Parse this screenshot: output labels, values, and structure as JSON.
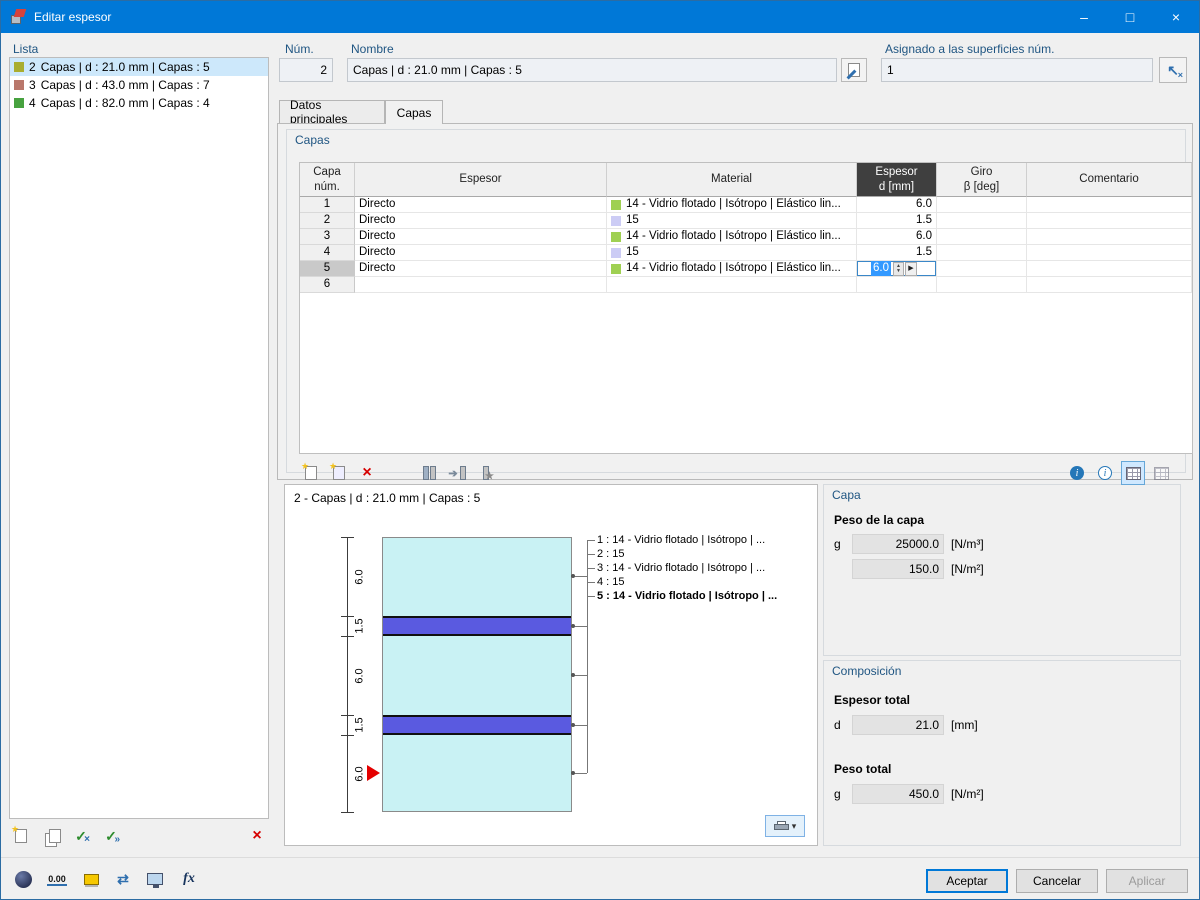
{
  "window": {
    "title": "Editar espesor"
  },
  "icons": {
    "minimize": "–",
    "maximize": "□",
    "close": "×",
    "star": "★",
    "delete_x": "×",
    "check": "✓",
    "chevrons": "»",
    "pick_arrow": "↖",
    "pick_x": "×",
    "spinner_up": "▲",
    "spinner_down": "▼",
    "detail_arrow": "▶",
    "dropdown": "▾",
    "info_i": "i",
    "arrows_lr": "⇄",
    "apply_arrow": "➔"
  },
  "sidebar": {
    "title": "Lista",
    "items": [
      {
        "num": "2",
        "label": "Capas | d : 21.0 mm | Capas : 5",
        "color": "#a9ad2f"
      },
      {
        "num": "3",
        "label": "Capas | d : 43.0 mm | Capas : 7",
        "color": "#b9776b"
      },
      {
        "num": "4",
        "label": "Capas | d : 82.0 mm | Capas : 4",
        "color": "#47a23f"
      }
    ]
  },
  "header": {
    "num_label": "Núm.",
    "num_value": "2",
    "name_label": "Nombre",
    "name_value": "Capas | d : 21.0 mm | Capas : 5",
    "assigned_label": "Asignado a las superficies núm.",
    "assigned_value": "1"
  },
  "tabs": {
    "main": "Datos principales",
    "layers": "Capas"
  },
  "layers": {
    "group_title": "Capas",
    "columns": {
      "num": "Capa\nnúm.",
      "thickness_type": "Espesor",
      "material": "Material",
      "d": "Espesor\nd [mm]",
      "beta": "Giro\nβ [deg]",
      "comment": "Comentario"
    },
    "rows": [
      {
        "num": "1",
        "type": "Directo",
        "material": "14 - Vidrio flotado | Isótropo | Elástico lin...",
        "color": "#9fd052",
        "d": "6.0",
        "beta": "",
        "comment": ""
      },
      {
        "num": "2",
        "type": "Directo",
        "material": "15",
        "color": "#ccccf5",
        "d": "1.5",
        "beta": "",
        "comment": ""
      },
      {
        "num": "3",
        "type": "Directo",
        "material": "14 - Vidrio flotado | Isótropo | Elástico lin...",
        "color": "#9fd052",
        "d": "6.0",
        "beta": "",
        "comment": ""
      },
      {
        "num": "4",
        "type": "Directo",
        "material": "15",
        "color": "#ccccf5",
        "d": "1.5",
        "beta": "",
        "comment": ""
      },
      {
        "num": "5",
        "type": "Directo",
        "material": "14 - Vidrio flotado | Isótropo | Elástico lin...",
        "color": "#9fd052",
        "d": "6.0",
        "beta": "",
        "comment": ""
      },
      {
        "num": "6",
        "type": "",
        "material": "",
        "d": "",
        "beta": "",
        "comment": ""
      }
    ]
  },
  "preview": {
    "title": "2 - Capas | d : 21.0 mm | Capas : 5",
    "dims": [
      "6.0",
      "1.5",
      "6.0",
      "1.5",
      "6.0"
    ],
    "legend": [
      "1 : 14 - Vidrio flotado | Isótropo | ...",
      "2 : 15",
      "3 : 14 - Vidrio flotado | Isótropo | ...",
      "4 : 15",
      "5 : 14 - Vidrio flotado | Isótropo | ..."
    ],
    "glass_color": "#c9f2f4",
    "interlayer_color": "#5a5ae0"
  },
  "layer_info": {
    "title": "Capa",
    "weight_label": "Peso de la capa",
    "g_label": "g",
    "rows": [
      {
        "value": "25000.0",
        "unit": "[N/m³]"
      },
      {
        "value": "150.0",
        "unit": "[N/m²]"
      }
    ]
  },
  "composition": {
    "title": "Composición",
    "thickness_label": "Espesor total",
    "d_label": "d",
    "d_value": "21.0",
    "d_unit": "[mm]",
    "weight_label": "Peso total",
    "g_label": "g",
    "g_value": "450.0",
    "g_unit": "[N/m²]"
  },
  "footer": {
    "accept": "Aceptar",
    "cancel": "Cancelar",
    "apply": "Aplicar",
    "decimal_icon_label": "0.00",
    "fx_icon_label": "fx"
  }
}
